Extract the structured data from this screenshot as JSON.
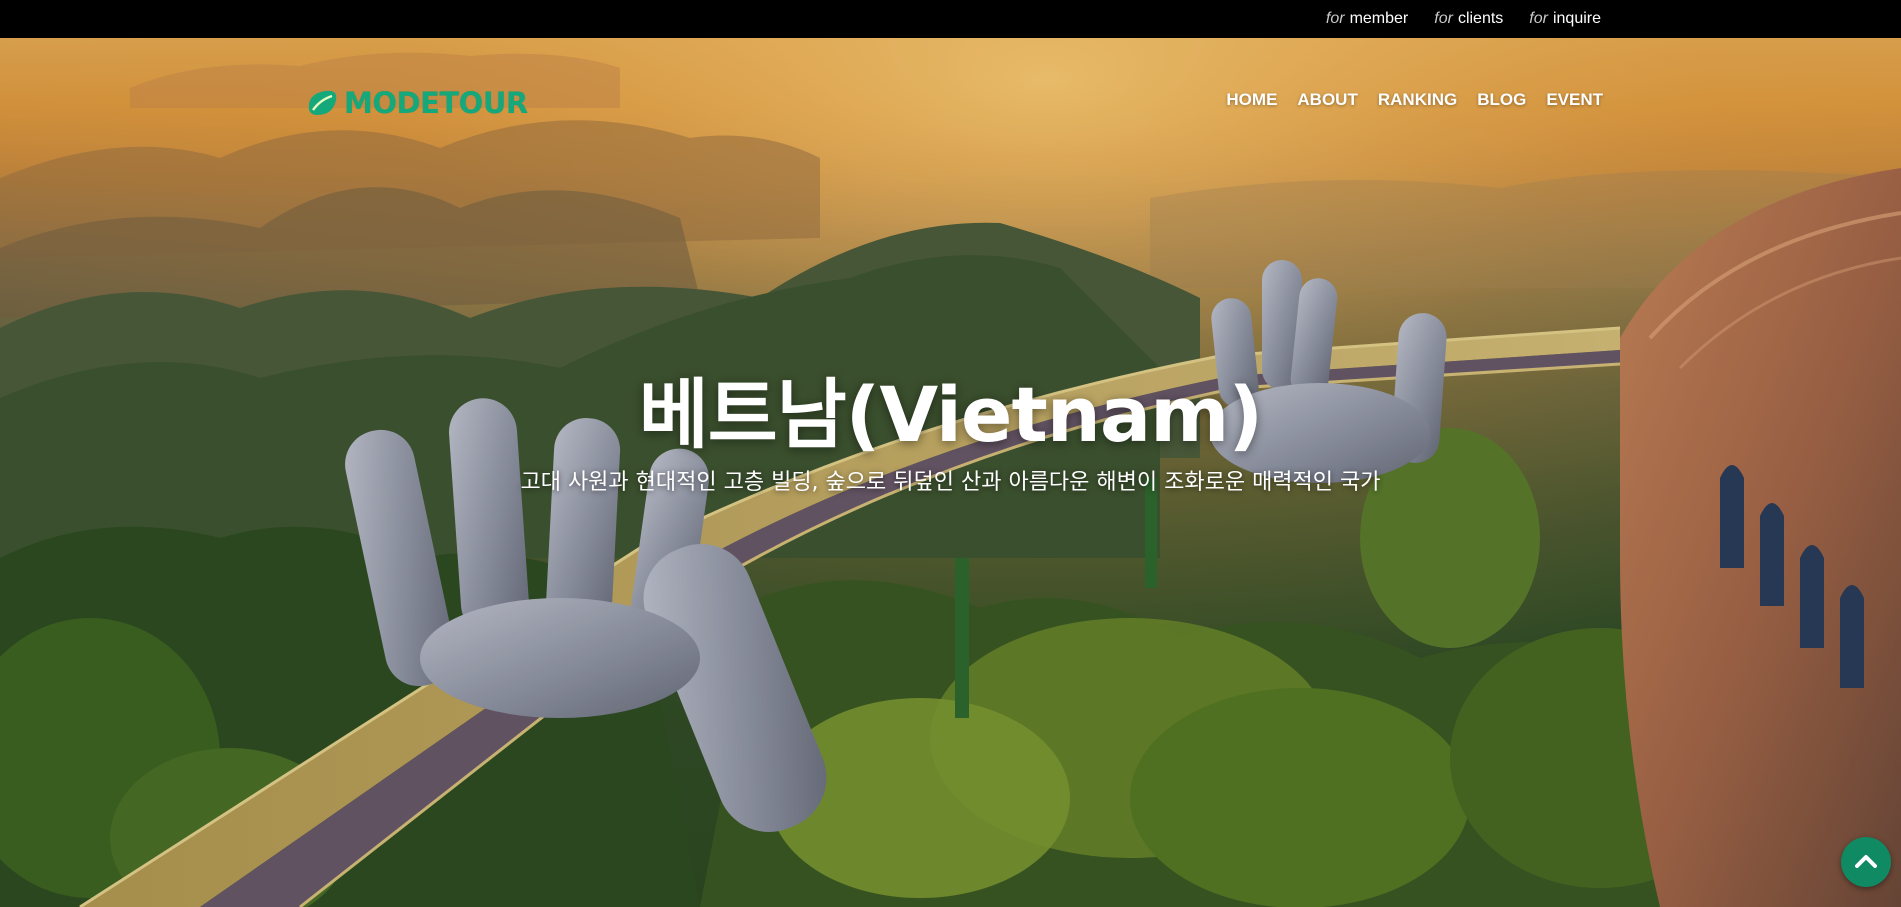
{
  "top_bar": {
    "links": [
      {
        "prefix": "for",
        "label": "member"
      },
      {
        "prefix": "for",
        "label": "clients"
      },
      {
        "prefix": "for",
        "label": "inquire"
      }
    ]
  },
  "header": {
    "logo_text": "MODETOUR",
    "nav": [
      "HOME",
      "ABOUT",
      "RANKING",
      "BLOG",
      "EVENT"
    ]
  },
  "hero": {
    "title": "베트남(Vietnam)",
    "subtitle": "고대 사원과 현대적인 고층 빌딩, 숲으로 뒤덮인 산과 아름다운 해변이 조화로운 매력적인 국가"
  },
  "icons": {
    "scroll_top": "chevron-up-icon",
    "logo_mark": "leaf-icon"
  },
  "colors": {
    "brand": "#14a87a",
    "scroll_button": "#0f8a62",
    "top_bar": "#000000"
  }
}
